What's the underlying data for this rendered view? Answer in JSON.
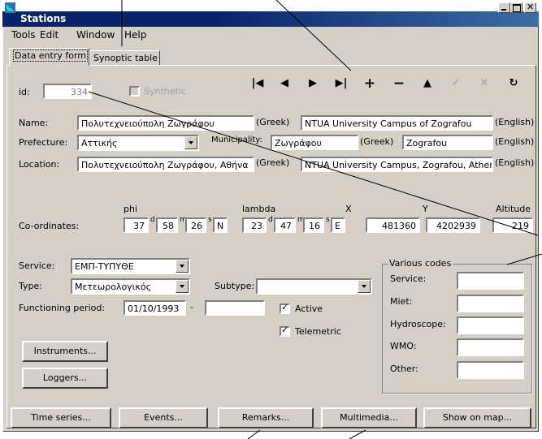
{
  "window": {
    "title": "Stations"
  },
  "menu": [
    "Tools",
    "Edit",
    "Window",
    "Help"
  ],
  "tabs": [
    "Data entry form",
    "Synoptic table"
  ],
  "toolbar": {
    "first": "|◀",
    "prev": "◀",
    "next": "▶",
    "last": "▶|",
    "add": "+",
    "remove": "−",
    "up": "▲",
    "post": "✓",
    "cancel": "✕",
    "refresh": "↻"
  },
  "id": {
    "label": "id:",
    "value": "334"
  },
  "synthetic": {
    "label": "Synthetic",
    "checked": false
  },
  "name": {
    "label": "Name:",
    "greek": "Πολυτεχνειούπολη Ζωγράφου",
    "greek_tag": "(Greek)",
    "english": "NTUA University Campus of Zografou",
    "english_tag": "(English)"
  },
  "prefecture": {
    "label": "Prefecture:",
    "value": "Αττικής"
  },
  "municipality": {
    "label": "Municipality:",
    "greek": "Ζωγράφου",
    "greek_tag": "(Greek)",
    "english": "Zografou",
    "english_tag": "(English)"
  },
  "location": {
    "label": "Location:",
    "greek": "Πολυτεχνειούπολη Ζωγράφου, Αθήνα",
    "greek_tag": "(Greek)",
    "english": "NTUA University Campus, Zografou, Athen",
    "english_tag": "(English)"
  },
  "coords": {
    "label": "Co-ordinates:",
    "phi_label": "phi",
    "lambda_label": "lambda",
    "x_label": "X",
    "y_label": "Y",
    "alt_label": "Altitude",
    "phi_d": "37",
    "phi_m": "58",
    "phi_s": "26",
    "phi_h": "N",
    "lam_d": "23",
    "lam_m": "47",
    "lam_s": "16",
    "lam_h": "E",
    "x": "481360",
    "y": "4202939",
    "alt": "219",
    "d": "d",
    "m": "m",
    "s": "s"
  },
  "service": {
    "label": "Service:",
    "value": "ΕΜΠ-ΤΥΠΥΘΕ"
  },
  "type": {
    "label": "Type:",
    "value": "Μετεωρολογικός"
  },
  "subtype": {
    "label": "Subtype:",
    "value": ""
  },
  "functioning": {
    "label": "Functioning period:",
    "start": "01/10/1993",
    "sep": "-",
    "end": ""
  },
  "active": {
    "label": "Active",
    "checked": true
  },
  "telemetric": {
    "label": "Telemetric",
    "checked": true
  },
  "various": {
    "title": "Various codes",
    "service": "Service:",
    "miet": "Miet:",
    "hydroscope": "Hydroscope:",
    "wmo": "WMO:",
    "other": "Other:"
  },
  "buttons": {
    "instruments": "Instruments...",
    "loggers": "Loggers...",
    "timeseries": "Time series...",
    "events": "Events...",
    "remarks": "Remarks...",
    "multimedia": "Multimedia...",
    "showmap": "Show on map..."
  }
}
